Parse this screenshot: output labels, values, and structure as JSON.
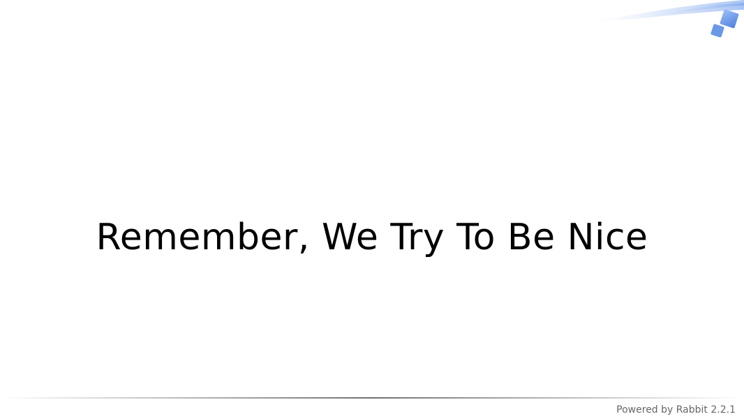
{
  "slide": {
    "title": "Remember, We Try To Be Nice",
    "footer": "Powered by Rabbit 2.2.1"
  },
  "decoration": {
    "corner_swoosh_icon": "blue-swoosh-icon",
    "corner_logo_icon": "blue-diamond-logo-icon",
    "accent_color": "#5b8fe6"
  }
}
